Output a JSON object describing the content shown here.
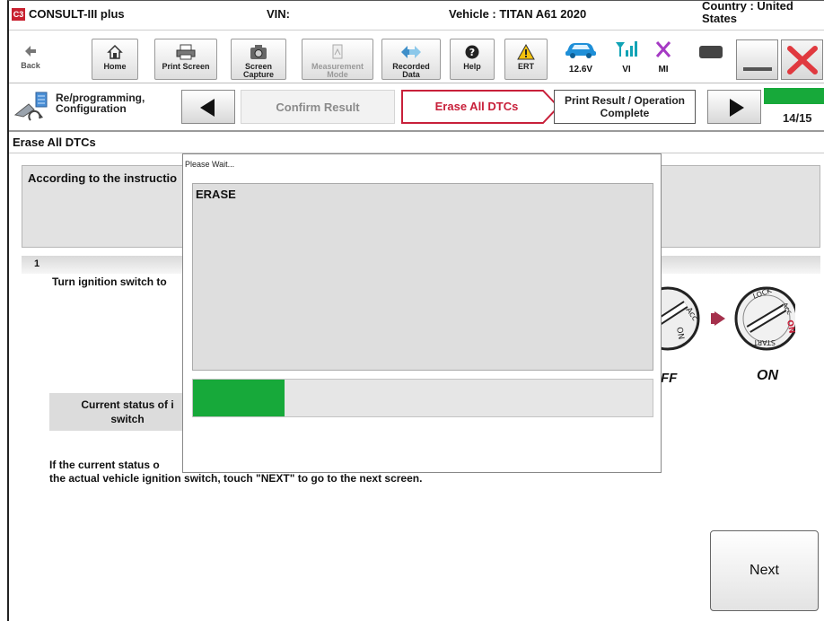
{
  "app": {
    "title": "CONSULT-III plus",
    "logo_text": "C3",
    "vin_label": "VIN:",
    "vehicle": "Vehicle : TITAN A61 2020",
    "country": "Country : United States"
  },
  "toolbar": {
    "back": "Back",
    "home": "Home",
    "print_screen": "Print Screen",
    "screen_capture": "Screen Capture",
    "measurement_mode": "Measurement Mode",
    "recorded_data": "Recorded Data",
    "help": "Help",
    "ert": "ERT",
    "voltage": "12.6V",
    "vi": "VI",
    "mi": "MI"
  },
  "breadcrumb": {
    "title": "Re/programming, Configuration",
    "step_prev": "Confirm Result",
    "step_current": "Erase All DTCs",
    "step_next": "Print Result / Operation Complete",
    "page": "14/15"
  },
  "section": {
    "title": "Erase All DTCs"
  },
  "instructions": {
    "heading": "According to the instructio",
    "step_number": "1",
    "step_text": "Turn ignition switch to",
    "status_label": "Current status of i switch",
    "bottom_line1": "If the current status o",
    "bottom_line2": "the actual vehicle ignition switch, touch \"NEXT\" to go to the next screen.",
    "off_label": "FF",
    "on_label": "ON"
  },
  "dialog": {
    "title": "Please Wait...",
    "message": "ERASE",
    "progress": 0.2
  },
  "buttons": {
    "next": "Next"
  },
  "colors": {
    "accent_red": "#c8203a",
    "progress_green": "#17a93a"
  }
}
